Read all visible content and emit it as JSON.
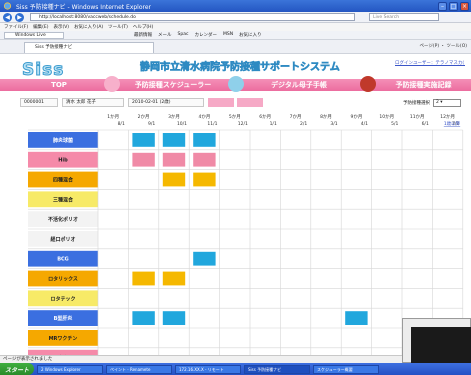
{
  "window": {
    "title": "Siss 予防接種ナビ - Windows Internet Explorer",
    "address": "http://localhost:8080/vaccweb/schedule.do",
    "search_placeholder": "Live Search",
    "menu": [
      "ファイル(F)",
      "編集(E)",
      "表示(V)",
      "お気に入り(A)",
      "ツール(T)",
      "ヘルプ(H)"
    ],
    "live_bar": "Windows Live",
    "live_items": [
      "最新情報",
      "メール",
      "Spac",
      "カレンダー",
      "MSN",
      "お気に入り"
    ],
    "tab_title": "Siss 予防接種ナビ",
    "tab_tools": "ページ(P) ・ ツール(O)"
  },
  "site": {
    "logo": "Siss",
    "banner": "静岡市立清水病院予防接種サポートシステム",
    "login_link": "ログインユーザー：テラノマスカ(ｔaxxk)",
    "nav": [
      {
        "label": "TOP"
      },
      {
        "label": "予防接種スケジューラー"
      },
      {
        "label": "デジタル母子手帳"
      },
      {
        "label": "予防接種実施記録"
      }
    ]
  },
  "info": {
    "patient_id": "0000001",
    "patient_name": "清水 太郎 花子",
    "birthdate": "2010-02-01 (2歳)",
    "pink_buttons": [
      "",
      ""
    ],
    "select_label": "予防接種選択",
    "select_value": "2"
  },
  "schedule": {
    "months": [
      {
        "top": "1か月",
        "bottom": "8/1"
      },
      {
        "top": "2か月",
        "bottom": "9/1"
      },
      {
        "top": "3か月",
        "bottom": "10/1"
      },
      {
        "top": "4か月",
        "bottom": "11/1"
      },
      {
        "top": "5か月",
        "bottom": "12/1"
      },
      {
        "top": "6か月",
        "bottom": "1/1"
      },
      {
        "top": "7か月",
        "bottom": "2/1"
      },
      {
        "top": "8か月",
        "bottom": "3/1"
      },
      {
        "top": "9か月",
        "bottom": "4/1"
      },
      {
        "top": "10か月",
        "bottom": "5/1"
      },
      {
        "top": "11か月",
        "bottom": "6/1"
      },
      {
        "top": "12か月",
        "bottom": "7/1"
      }
    ],
    "print_link": "1歳以降",
    "rows": [
      {
        "label": "肺炎球菌",
        "color": "#3b6fe0",
        "text_color": "#ffffff"
      },
      {
        "label": "Hib",
        "color": "#f58aa9",
        "text_color": "#222222"
      },
      {
        "label": "四種混合",
        "color": "#f5a800",
        "text_color": "#222222"
      },
      {
        "label": "三種混合",
        "color": "#f7ea67",
        "text_color": "#222222"
      },
      {
        "label": "不活化ポリオ",
        "color": "#f3f3f3",
        "text_color": "#222222"
      },
      {
        "label": "経口ポリオ",
        "color": "#f3f3f3",
        "text_color": "#222222"
      },
      {
        "label": "BCG",
        "color": "#3b6fe0",
        "text_color": "#ffffff"
      },
      {
        "label": "ロタリックス",
        "color": "#f5a800",
        "text_color": "#222222"
      },
      {
        "label": "ロタテック",
        "color": "#f7ea67",
        "text_color": "#222222"
      },
      {
        "label": "B型肝炎",
        "color": "#3b6fe0",
        "text_color": "#ffffff"
      },
      {
        "label": "MRワクチン",
        "color": "#f5a800",
        "text_color": "#222222"
      },
      {
        "label": "水痘",
        "color": "#f58aa9",
        "text_color": "#222222"
      }
    ],
    "chips": [
      {
        "row": 0,
        "col": 1,
        "text": "",
        "color": "#21a7dd"
      },
      {
        "row": 0,
        "col": 2,
        "text": "",
        "color": "#21a7dd"
      },
      {
        "row": 0,
        "col": 3,
        "text": "",
        "color": "#21a7dd"
      },
      {
        "row": 1,
        "col": 1,
        "text": "",
        "color": "#f08aa6"
      },
      {
        "row": 1,
        "col": 2,
        "text": "",
        "color": "#f08aa6"
      },
      {
        "row": 1,
        "col": 3,
        "text": "",
        "color": "#f08aa6"
      },
      {
        "row": 2,
        "col": 2,
        "text": "",
        "color": "#f5b800"
      },
      {
        "row": 2,
        "col": 3,
        "text": "",
        "color": "#f5b800"
      },
      {
        "row": 6,
        "col": 3,
        "text": "",
        "color": "#21a7dd"
      },
      {
        "row": 7,
        "col": 1,
        "text": "",
        "color": "#f5b800"
      },
      {
        "row": 7,
        "col": 2,
        "text": "",
        "color": "#f5b800"
      },
      {
        "row": 9,
        "col": 1,
        "text": "",
        "color": "#21a7dd"
      },
      {
        "row": 9,
        "col": 2,
        "text": "",
        "color": "#21a7dd"
      },
      {
        "row": 9,
        "col": 8,
        "text": "",
        "color": "#21a7dd"
      }
    ]
  },
  "status_bar": "ページが表示されました",
  "taskbar": {
    "start": "スタート",
    "items": [
      "2 Windows Explorer",
      "ペイント - Renamete",
      "172.16.XX.X - リモート",
      "Siss 予防接種ナビ",
      "スケジューラー概要"
    ]
  }
}
